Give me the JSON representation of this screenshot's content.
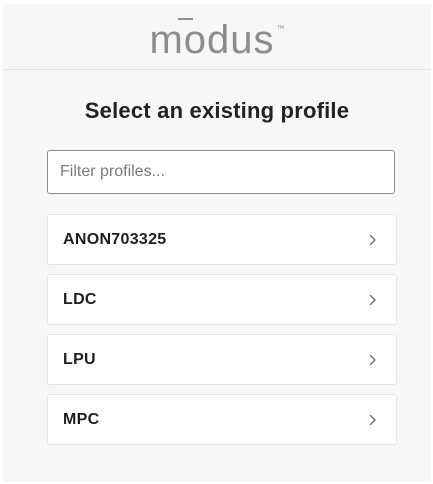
{
  "brand": {
    "logo_text": "modus",
    "trademark": "™"
  },
  "page": {
    "title": "Select an existing profile"
  },
  "filter": {
    "placeholder": "Filter profiles...",
    "value": ""
  },
  "profiles": [
    {
      "label": "ANON703325",
      "icon": "chevron-right-icon"
    },
    {
      "label": "LDC",
      "icon": "chevron-right-icon"
    },
    {
      "label": "LPU",
      "icon": "chevron-right-icon"
    },
    {
      "label": "MPC",
      "icon": "chevron-right-icon"
    }
  ],
  "colors": {
    "background": "#f7f7f7",
    "logo": "#8c8c8c",
    "title": "#222222",
    "card": "#ffffff"
  }
}
